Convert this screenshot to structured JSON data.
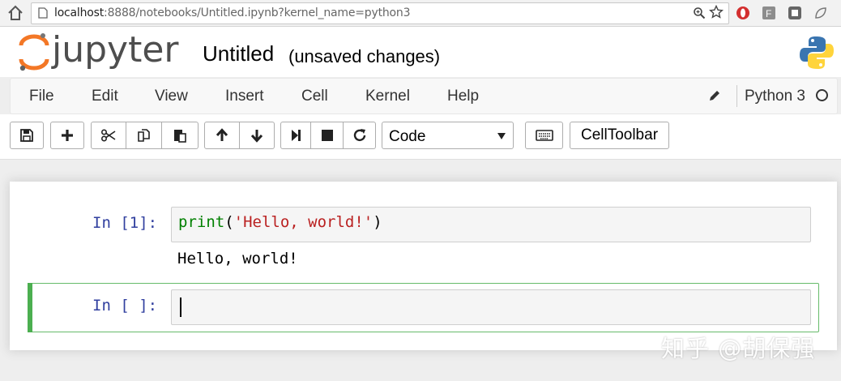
{
  "browser": {
    "url_host": "localhost",
    "url_rest": ":8888/notebooks/Untitled.ipynb?kernel_name=python3"
  },
  "header": {
    "logo_text": "jupyter",
    "title": "Untitled",
    "status": "(unsaved changes)"
  },
  "menubar": {
    "items": [
      "File",
      "Edit",
      "View",
      "Insert",
      "Cell",
      "Kernel",
      "Help"
    ],
    "kernel_name": "Python 3"
  },
  "toolbar": {
    "icons": [
      "save-icon",
      "plus-icon",
      "scissors-icon",
      "copy-icon",
      "paste-icon",
      "arrow-up-icon",
      "arrow-down-icon",
      "step-forward-icon",
      "stop-icon",
      "refresh-icon",
      "keyboard-icon"
    ],
    "cell_type": "Code",
    "celltoolbar_label": "CellToolbar"
  },
  "cells": [
    {
      "prompt": "In [1]:",
      "code": {
        "func": "print",
        "open": "(",
        "arg": "'Hello, world!'",
        "close": ")"
      },
      "output": "Hello, world!"
    },
    {
      "prompt": "In [ ]:",
      "code": ""
    }
  ],
  "watermark": "知乎 @胡保强",
  "colors": {
    "prompt": "#303f9f",
    "keyword": "#008000",
    "string": "#ba2121",
    "selected_cell_bar": "#4caf50"
  }
}
